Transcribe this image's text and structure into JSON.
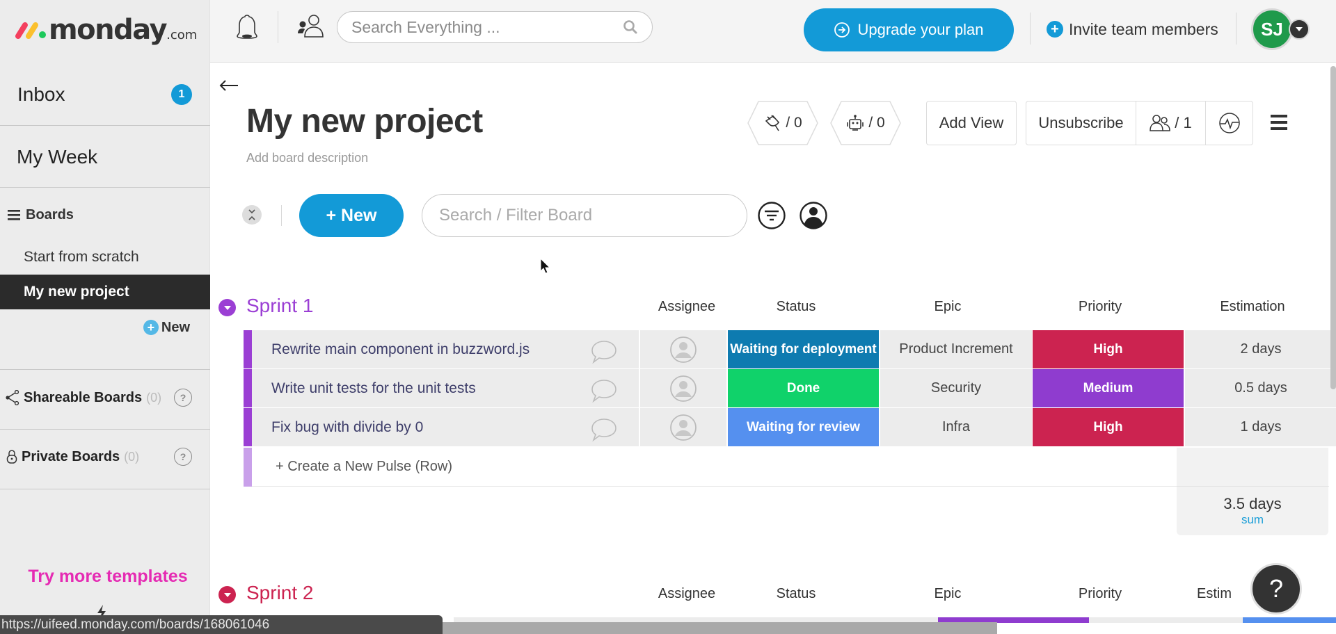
{
  "app": {
    "brand": "monday",
    "brand_suffix": ".com"
  },
  "sidebar": {
    "inbox": {
      "label": "Inbox",
      "badge": "1"
    },
    "my_week": {
      "label": "My Week"
    },
    "boards_header": "Boards",
    "boards": [
      {
        "label": "Start from scratch",
        "active": false
      },
      {
        "label": "My new project",
        "active": true
      }
    ],
    "new_label": "New",
    "shareable": {
      "label": "Shareable Boards",
      "count": "(0)"
    },
    "private": {
      "label": "Private Boards",
      "count": "(0)"
    },
    "templates_link": "Try more templates"
  },
  "topbar": {
    "search_placeholder": "Search Everything ...",
    "upgrade_label": "Upgrade your plan",
    "invite_label": "Invite team members",
    "avatar_initials": "SJ"
  },
  "board": {
    "title": "My new project",
    "description_placeholder": "Add board description",
    "integrations_count": "/ 0",
    "automations_count": "/ 0",
    "add_view_label": "Add View",
    "unsubscribe_label": "Unsubscribe",
    "members_count": "/ 1",
    "new_button_label": "+ New",
    "filter_placeholder": "Search / Filter Board"
  },
  "columns": [
    "Assignee",
    "Status",
    "Epic",
    "Priority",
    "Estimation"
  ],
  "groups": [
    {
      "title": "Sprint 1",
      "color": "#9b3fd4",
      "rows": [
        {
          "name": "Rewrite main component in buzzword.js",
          "status": "Waiting for deployment",
          "status_color": "#0e7bb0",
          "epic": "Product Increment",
          "priority": "High",
          "priority_color": "#cc2350",
          "estimation": "2 days"
        },
        {
          "name": "Write unit tests for the unit tests",
          "status": "Done",
          "status_color": "#10d26a",
          "epic": "Security",
          "priority": "Medium",
          "priority_color": "#8f3ccf",
          "estimation": "0.5 days"
        },
        {
          "name": "Fix bug with divide by 0",
          "status": "Waiting for review",
          "status_color": "#5590ef",
          "epic": "Infra",
          "priority": "High",
          "priority_color": "#cc2350",
          "estimation": "1 days"
        }
      ],
      "create_row_label": "+ Create a New Pulse (Row)",
      "summary": {
        "value": "3.5 days",
        "label": "sum"
      }
    },
    {
      "title": "Sprint 2",
      "color": "#cc2350",
      "first_row_status_color": "#8f3ccf",
      "first_row_priority_color": "#5590ef",
      "estimation_header_partial": "Estim"
    }
  ],
  "help_label": "?",
  "browser_status_url": "https://uifeed.monday.com/boards/168061046",
  "colors": {
    "accent": "#139ad7",
    "templates_link": "#e52bb3",
    "sidebar_bg": "#ececec"
  }
}
